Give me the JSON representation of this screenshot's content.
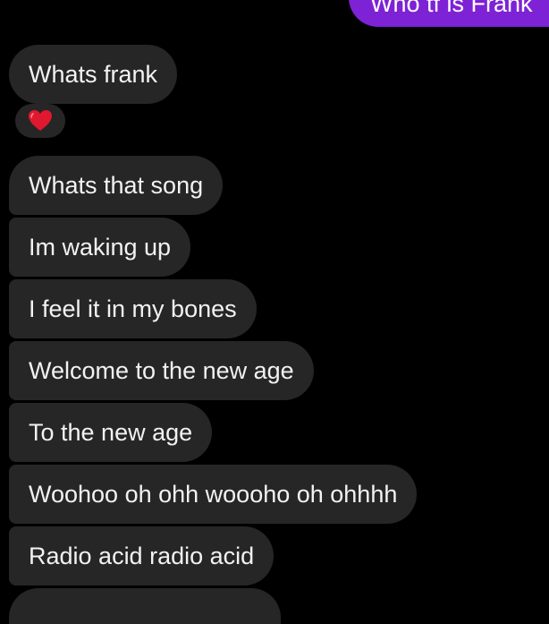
{
  "conversation": {
    "outgoing_message": "Who tf is Frank",
    "reaction_icon": "red-heart-icon",
    "colors": {
      "background": "#000000",
      "incoming_bubble": "#262626",
      "outgoing_bubble": "#7e22d6",
      "heart": "#e0182f"
    },
    "incoming_messages": [
      "Whats frank",
      "Whats that song",
      "Im waking up",
      "I feel it in my bones",
      "Welcome to the new age",
      "To the new age",
      "Woohoo oh ohh woooho oh ohhhh",
      "Radio acid radio acid"
    ]
  }
}
